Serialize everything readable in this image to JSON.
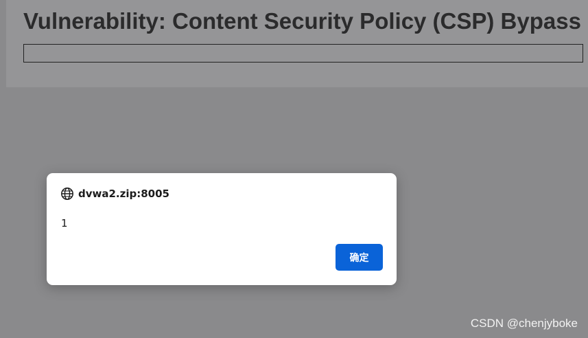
{
  "page": {
    "title": "Vulnerability: Content Security Policy (CSP) Bypass",
    "content_box_text": ""
  },
  "alert_dialog": {
    "origin": "dvwa2.zip:8005",
    "origin_icon": "globe-icon",
    "message": "1",
    "ok_label": "确定",
    "ok_color": "#0a63d8"
  },
  "watermark": {
    "text": "CSDN @chenjyboke"
  }
}
